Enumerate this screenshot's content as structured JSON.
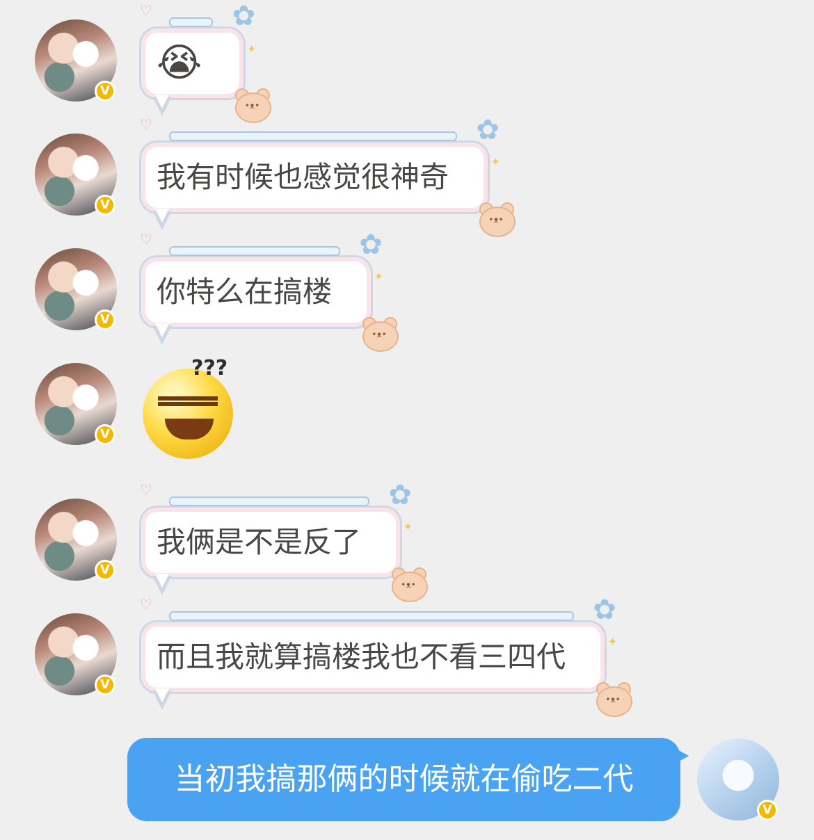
{
  "messages": [
    {
      "side": "left",
      "type": "emoji-bubble",
      "content": "😭"
    },
    {
      "side": "left",
      "type": "text",
      "content": "我有时候也感觉很神奇"
    },
    {
      "side": "left",
      "type": "text",
      "content": "你特么在搞楼"
    },
    {
      "side": "left",
      "type": "sticker",
      "content": "???"
    },
    {
      "side": "left",
      "type": "text",
      "content": "我俩是不是反了"
    },
    {
      "side": "left",
      "type": "text",
      "content": "而且我就算搞楼我也不看三四代"
    },
    {
      "side": "right",
      "type": "text",
      "content": "当初我搞那俩的时候就在偷吃二代"
    }
  ],
  "badge": {
    "label": "V"
  },
  "colors": {
    "background": "#efefef",
    "my_bubble": "#4aa3f2",
    "badge": "#f5b800",
    "text": "#4a4646"
  }
}
